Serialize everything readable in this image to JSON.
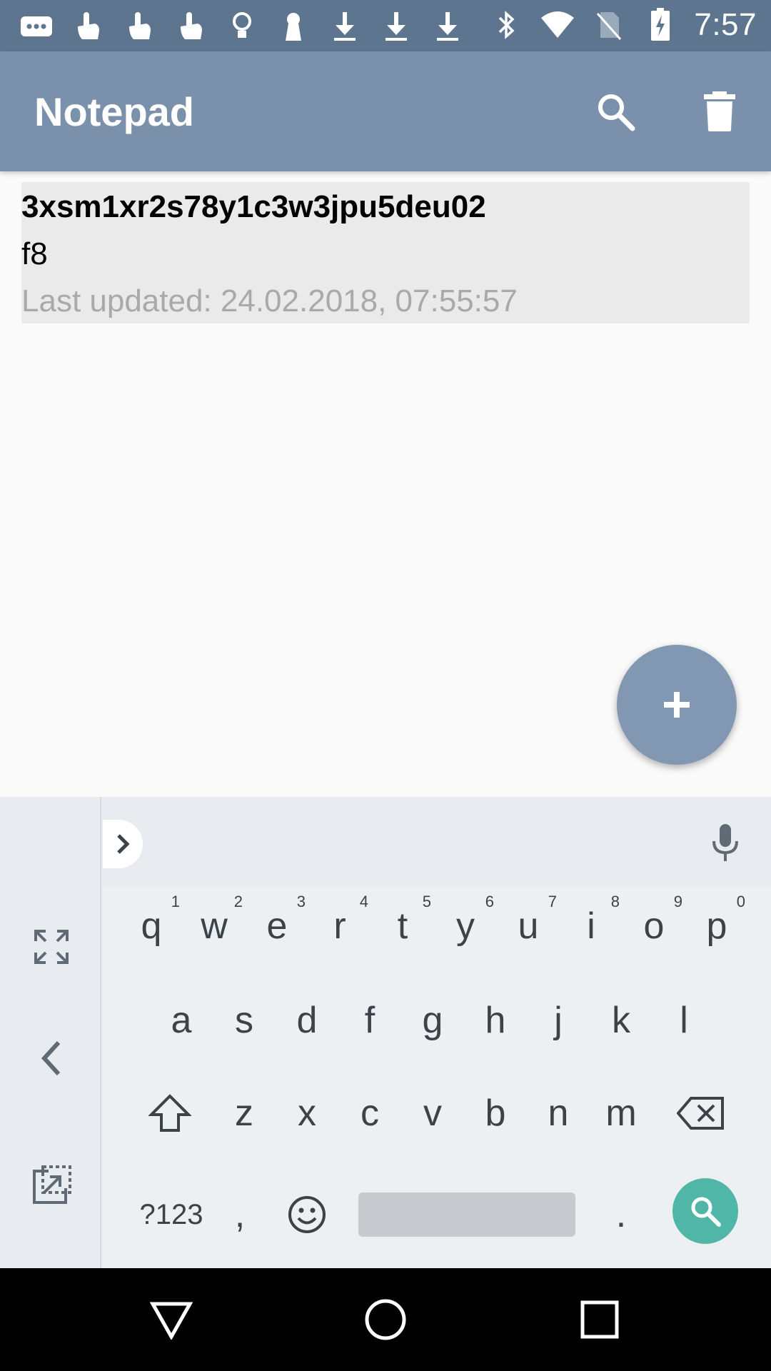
{
  "status_bar": {
    "time": "7:57",
    "left_icons": [
      "message-icon",
      "touch-icon",
      "touch-icon",
      "touch-icon",
      "bulb-icon",
      "keyhole-icon",
      "download-icon",
      "download-icon",
      "download-icon"
    ],
    "right_icons": [
      "bluetooth-icon",
      "wifi-icon",
      "no-sim-icon",
      "battery-charging-icon"
    ]
  },
  "app_bar": {
    "title": "Notepad",
    "actions": [
      "search-icon",
      "delete-icon"
    ]
  },
  "notes": [
    {
      "title": "3xsm1xr2s78y1c3w3jpu5deu02",
      "body": "f8",
      "updated": "Last updated: 24.02.2018, 07:55:57"
    }
  ],
  "fab": {
    "icon": "plus-icon"
  },
  "keyboard": {
    "row1": [
      {
        "k": "q",
        "h": "1"
      },
      {
        "k": "w",
        "h": "2"
      },
      {
        "k": "e",
        "h": "3"
      },
      {
        "k": "r",
        "h": "4"
      },
      {
        "k": "t",
        "h": "5"
      },
      {
        "k": "y",
        "h": "6"
      },
      {
        "k": "u",
        "h": "7"
      },
      {
        "k": "i",
        "h": "8"
      },
      {
        "k": "o",
        "h": "9"
      },
      {
        "k": "p",
        "h": "0"
      }
    ],
    "row2": [
      "a",
      "s",
      "d",
      "f",
      "g",
      "h",
      "j",
      "k",
      "l"
    ],
    "row3": [
      "z",
      "x",
      "c",
      "v",
      "b",
      "n",
      "m"
    ],
    "symbols_key": "?123",
    "comma_key": ",",
    "period_key": ".",
    "accent_color": "#4fb6a8"
  },
  "nav_bar": [
    "back-icon",
    "home-icon",
    "recents-icon"
  ]
}
